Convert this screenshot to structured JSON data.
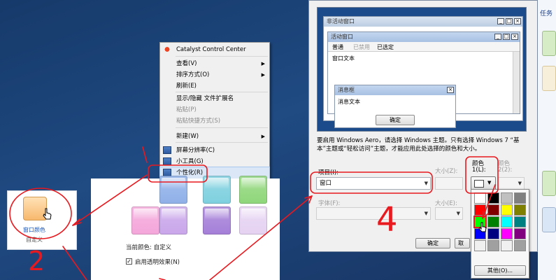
{
  "context_menu": {
    "items": [
      {
        "label": "Catalyst Control Center",
        "disabled": false,
        "submenu": false,
        "icon": "catalyst-icon"
      },
      {
        "label": "查看(V)",
        "disabled": false,
        "submenu": true
      },
      {
        "label": "排序方式(O)",
        "disabled": false,
        "submenu": true
      },
      {
        "label": "刷新(E)",
        "disabled": false,
        "submenu": false
      },
      {
        "label": "显示/隐藏 文件扩展名",
        "disabled": false,
        "submenu": false
      },
      {
        "label": "粘贴(P)",
        "disabled": true,
        "submenu": false
      },
      {
        "label": "粘贴快捷方式(S)",
        "disabled": true,
        "submenu": false
      },
      {
        "label": "新建(W)",
        "disabled": false,
        "submenu": true
      },
      {
        "label": "屏幕分辨率(C)",
        "disabled": false,
        "submenu": false,
        "icon": "monitor-icon"
      },
      {
        "label": "小工具(G)",
        "disabled": false,
        "submenu": false,
        "icon": "gadget-icon"
      },
      {
        "label": "个性化(R)",
        "disabled": false,
        "submenu": false,
        "icon": "personalize-icon",
        "highlighted": true
      }
    ]
  },
  "personalization": {
    "current_color_label": "当前颜色: 自定义",
    "transparency_label": "启用透明效果(N)",
    "transparency_checked": true,
    "swatch_colors": [
      "#8fb0e8",
      "#7ed0df",
      "#8fd67a",
      "#f4a6da",
      "#c9a6ea",
      "#a57fd8",
      "#e5d2f2"
    ]
  },
  "tile": {
    "label": "窗口颜色",
    "sub": "自定义"
  },
  "preview": {
    "inactive_title": "非活动窗口",
    "active_title": "活动窗口",
    "menu_normal": "普通",
    "menu_disabled": "已禁用",
    "menu_selected": "已选定",
    "window_text": "窗口文本",
    "msgbox_title": "消息框",
    "msgbox_text": "消息文本",
    "ok_label": "确定"
  },
  "dialog": {
    "description": "要启用 Windows Aero，请选择 Windows 主题。只有选择 Windows 7 “基本”主题或“轻松访问”主题，才能应用此处选择的颜色和大小。",
    "item_label": "项目(I):",
    "item_value": "窗口",
    "size_label": "大小(Z):",
    "color1_label": "颜色",
    "color1_sub": "1(L):",
    "color2_label": "颜色",
    "color2_sub": "2(2):",
    "font_label": "字体(F):",
    "font_size_label": "大小(E):",
    "font_color_label": "颜色",
    "ok_label": "确定",
    "cancel_label": "取"
  },
  "picker": {
    "colors": [
      "#ffffff",
      "#000000",
      "#c0c0c0",
      "#808080",
      "#ff0000",
      "#800000",
      "#ffff00",
      "#808000",
      "#00ff00",
      "#008000",
      "#00ffff",
      "#008080",
      "#0000ff",
      "#000080",
      "#ff00ff",
      "#800080",
      "#f0f0f0",
      "#a0a0a0",
      "#f0f0f0",
      "#a0a0a0"
    ],
    "other_label": "其他(O)..."
  },
  "right_sliver": {
    "label": "任务"
  },
  "annotations": {
    "num_two": "2",
    "num_four": "4"
  }
}
